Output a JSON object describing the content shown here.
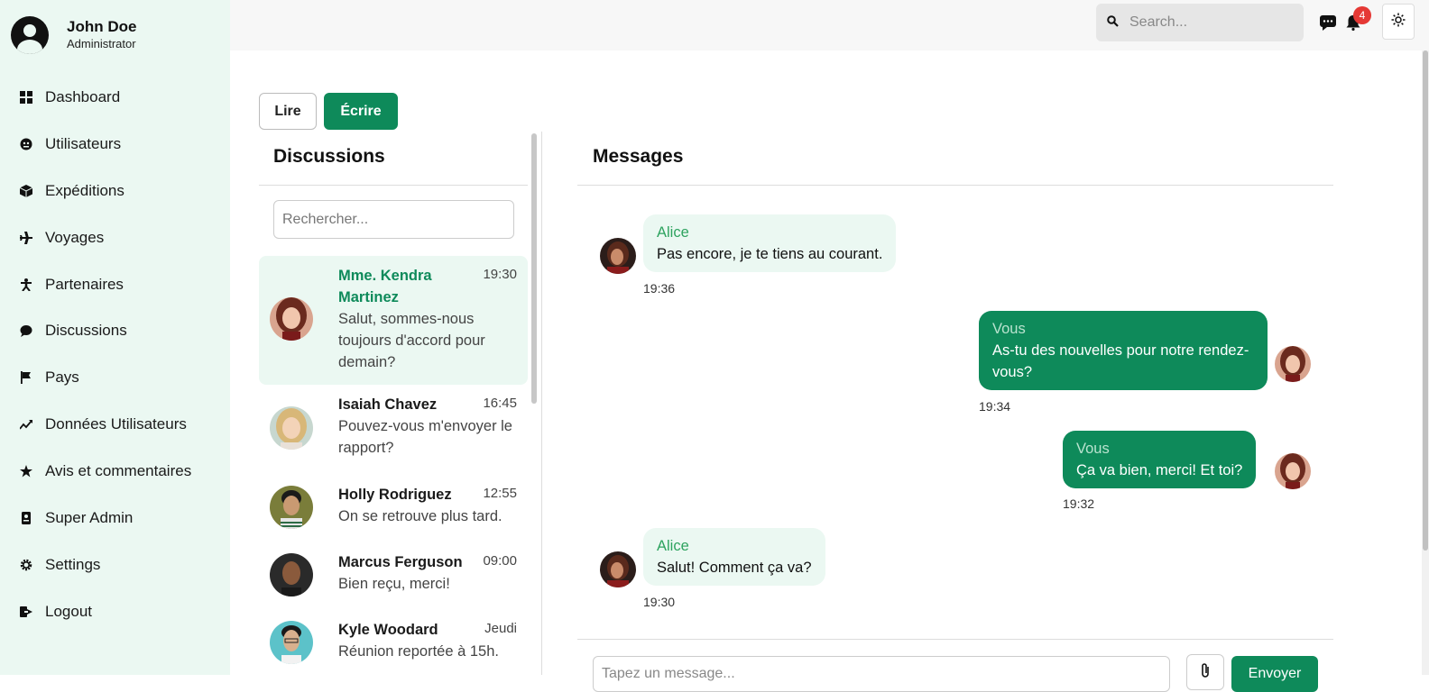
{
  "profile": {
    "name": "John Doe",
    "role": "Administrator"
  },
  "sidebar": {
    "items": [
      {
        "label": "Dashboard",
        "icon": "grid-icon"
      },
      {
        "label": "Utilisateurs",
        "icon": "users-icon"
      },
      {
        "label": "Expéditions",
        "icon": "box-icon"
      },
      {
        "label": "Voyages",
        "icon": "plane-icon"
      },
      {
        "label": "Partenaires",
        "icon": "person-icon"
      },
      {
        "label": "Discussions",
        "icon": "chat-icon"
      },
      {
        "label": "Pays",
        "icon": "flag-icon"
      },
      {
        "label": "Données Utilisateurs",
        "icon": "chart-line-icon"
      },
      {
        "label": "Avis et commentaires",
        "icon": "star-icon"
      },
      {
        "label": "Super Admin",
        "icon": "badge-icon"
      },
      {
        "label": "Settings",
        "icon": "gear-icon"
      },
      {
        "label": "Logout",
        "icon": "logout-icon"
      }
    ]
  },
  "topbar": {
    "search_placeholder": "Search...",
    "notification_count": "4"
  },
  "tabs": {
    "read": "Lire",
    "write": "Écrire"
  },
  "discussions": {
    "title": "Discussions",
    "search_placeholder": "Rechercher...",
    "items": [
      {
        "name": "Mme. Kendra Martinez",
        "time": "19:30",
        "preview": "Salut, sommes-nous toujours d'accord pour demain?"
      },
      {
        "name": "Isaiah Chavez",
        "time": "16:45",
        "preview": "Pouvez-vous m'envoyer le rapport?"
      },
      {
        "name": "Holly Rodriguez",
        "time": "12:55",
        "preview": "On se retrouve plus tard."
      },
      {
        "name": "Marcus Ferguson",
        "time": "09:00",
        "preview": "Bien reçu, merci!"
      },
      {
        "name": "Kyle Woodard",
        "time": "Jeudi",
        "preview": "Réunion reportée à 15h."
      }
    ]
  },
  "messages": {
    "title": "Messages",
    "items": [
      {
        "sender": "Alice",
        "text": "Pas encore, je te tiens au courant.",
        "time": "19:36"
      },
      {
        "sender": "Vous",
        "text": "As-tu des nouvelles pour notre rendez-vous?",
        "time": "19:34"
      },
      {
        "sender": "Vous",
        "text": "Ça va bien, merci! Et toi?",
        "time": "19:32"
      },
      {
        "sender": "Alice",
        "text": "Salut! Comment ça va?",
        "time": "19:30"
      }
    ],
    "compose_placeholder": "Tapez un message...",
    "send_label": "Envoyer"
  },
  "colors": {
    "accent": "#0e8a5a",
    "sidebar_bg": "#ebf8f2",
    "badge": "#e53935"
  }
}
